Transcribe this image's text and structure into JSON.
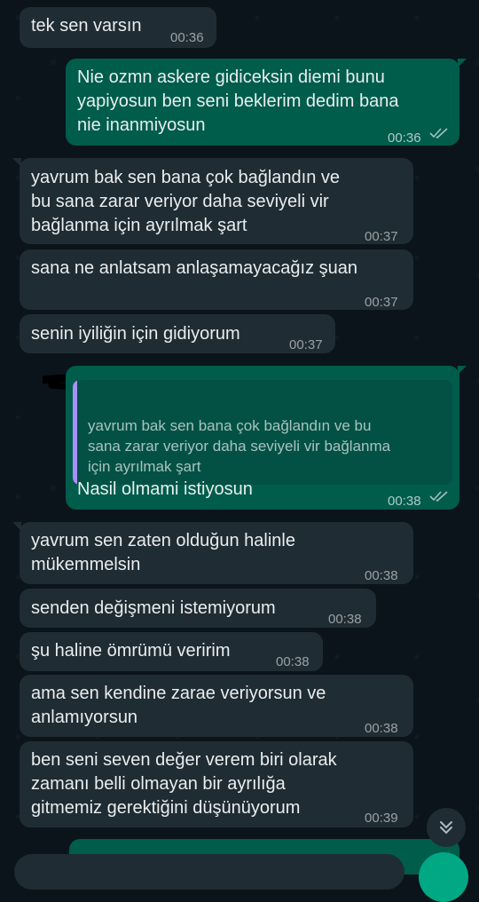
{
  "messages": [
    {
      "dir": "in",
      "text": "tek sen varsın",
      "time": "00:36"
    },
    {
      "dir": "out",
      "text": "Nie ozmn askere gidiceksin diemi bunu\nyapiyosun ben seni beklerim dedim bana\nnie inanmiyosun",
      "time": "00:36"
    },
    {
      "dir": "in",
      "text": "yavrum bak sen bana çok bağlandın ve\nbu sana zarar veriyor daha seviyeli vir\nbağlanma için ayrılmak şart",
      "time": "00:37"
    },
    {
      "dir": "in",
      "text": "sana ne anlatsam anlaşamayacağız şuan",
      "time": "00:37"
    },
    {
      "dir": "in",
      "text": "senin iyiliğin için gidiyorum",
      "time": "00:37"
    },
    {
      "dir": "out",
      "quoted_text": "yavrum bak sen bana çok bağlandın ve bu\nsana zarar veriyor daha seviyeli vir bağlanma\niçin ayrılmak şart",
      "text": "Nasil olmami istiyosun",
      "time": "00:38"
    },
    {
      "dir": "in",
      "text": "yavrum sen zaten olduğun halinle\nmükemmelsin",
      "time": "00:38"
    },
    {
      "dir": "in",
      "text": "senden değişmeni istemiyorum",
      "time": "00:38"
    },
    {
      "dir": "in",
      "text": "şu haline ömrümü veririm",
      "time": "00:38"
    },
    {
      "dir": "in",
      "text": "ama sen kendine zarae veriyorsun ve\nanlamıyorsun",
      "time": "00:38"
    },
    {
      "dir": "in",
      "text": "ben seni seven değer verem biri olarak\nzamanı belli olmayan bir ayrılığa\ngitmemiz gerektiğini düşünüyorum",
      "time": "00:39"
    }
  ],
  "colors": {
    "background": "#0b141a",
    "incoming": "#202c33",
    "outgoing": "#005c4b",
    "read_ticks": "#53bdeb",
    "accent": "#00a884"
  },
  "icons": {
    "read_receipt": "double-check-icon",
    "scroll_down": "double-chevron-down-icon",
    "mic": "mic-icon"
  }
}
